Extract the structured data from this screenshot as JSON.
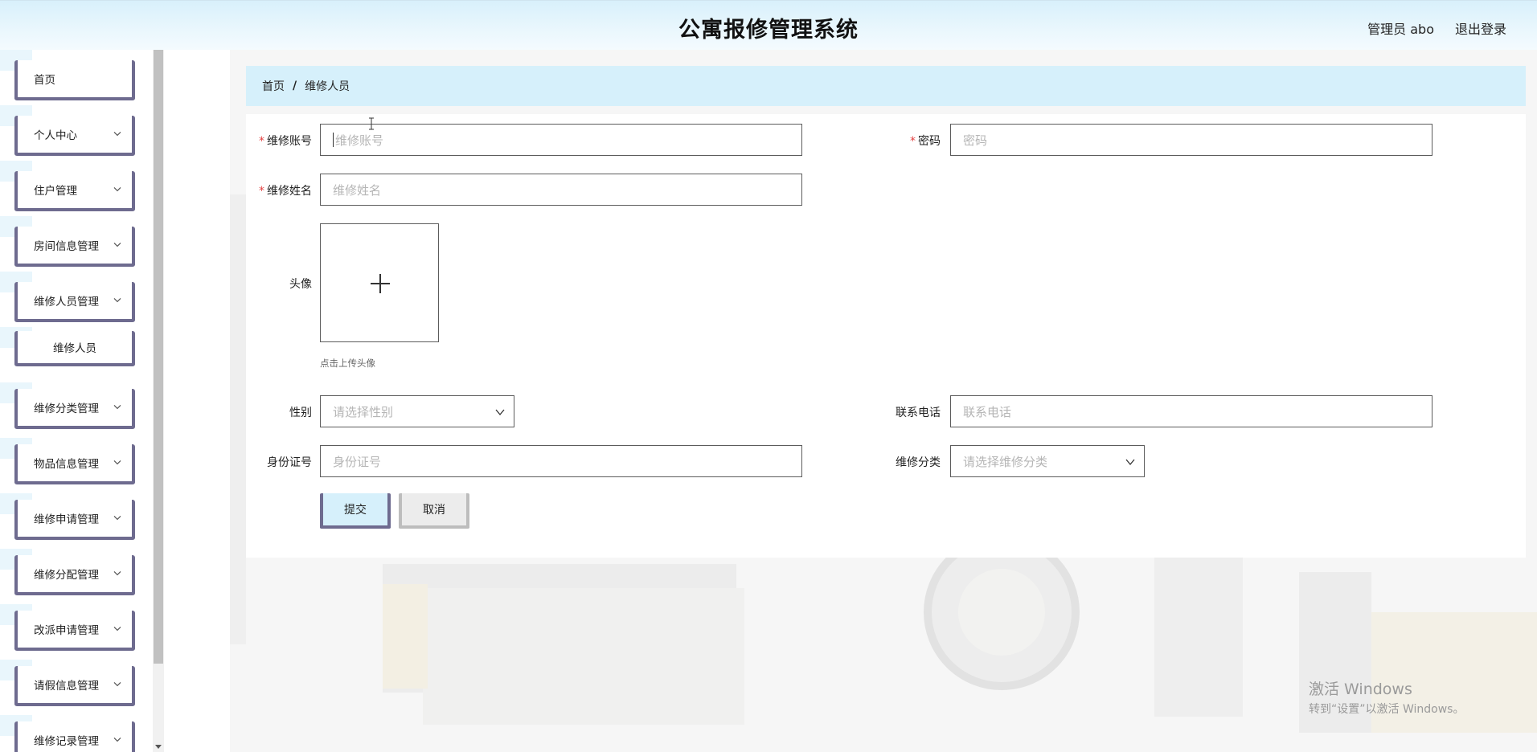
{
  "header": {
    "title": "公寓报修管理系统",
    "user": "管理员 abo",
    "logout": "退出登录"
  },
  "sidebar": {
    "items": [
      {
        "label": "首页",
        "has_chevron": false
      },
      {
        "label": "个人中心",
        "has_chevron": true
      },
      {
        "label": "住户管理",
        "has_chevron": true
      },
      {
        "label": "房间信息管理",
        "has_chevron": true
      },
      {
        "label": "维修人员管理",
        "has_chevron": true
      },
      {
        "label": "维修人员",
        "has_chevron": false
      },
      {
        "label": "维修分类管理",
        "has_chevron": true
      },
      {
        "label": "物品信息管理",
        "has_chevron": true
      },
      {
        "label": "维修申请管理",
        "has_chevron": true
      },
      {
        "label": "维修分配管理",
        "has_chevron": true
      },
      {
        "label": "改派申请管理",
        "has_chevron": true
      },
      {
        "label": "请假信息管理",
        "has_chevron": true
      },
      {
        "label": "维修记录管理",
        "has_chevron": true
      }
    ]
  },
  "breadcrumb": {
    "home": "首页",
    "separator": "/",
    "current": "维修人员"
  },
  "form": {
    "account": {
      "label": "维修账号",
      "placeholder": "维修账号",
      "required": true
    },
    "password": {
      "label": "密码",
      "placeholder": "密码",
      "required": true
    },
    "name": {
      "label": "维修姓名",
      "placeholder": "维修姓名",
      "required": true
    },
    "avatar": {
      "label": "头像",
      "hint": "点击上传头像"
    },
    "gender": {
      "label": "性别",
      "placeholder": "请选择性别"
    },
    "phone": {
      "label": "联系电话",
      "placeholder": "联系电话"
    },
    "idcard": {
      "label": "身份证号",
      "placeholder": "身份证号"
    },
    "category": {
      "label": "维修分类",
      "placeholder": "请选择维修分类"
    },
    "required_mark": "*",
    "submit": "提交",
    "cancel": "取消"
  },
  "watermark": {
    "line1": "激活 Windows",
    "line2": "转到“设置”以激活 Windows。"
  },
  "colors": {
    "accent_light": "#d6f0fb",
    "menu_border": "#6e6b8f",
    "required": "#e34242"
  }
}
